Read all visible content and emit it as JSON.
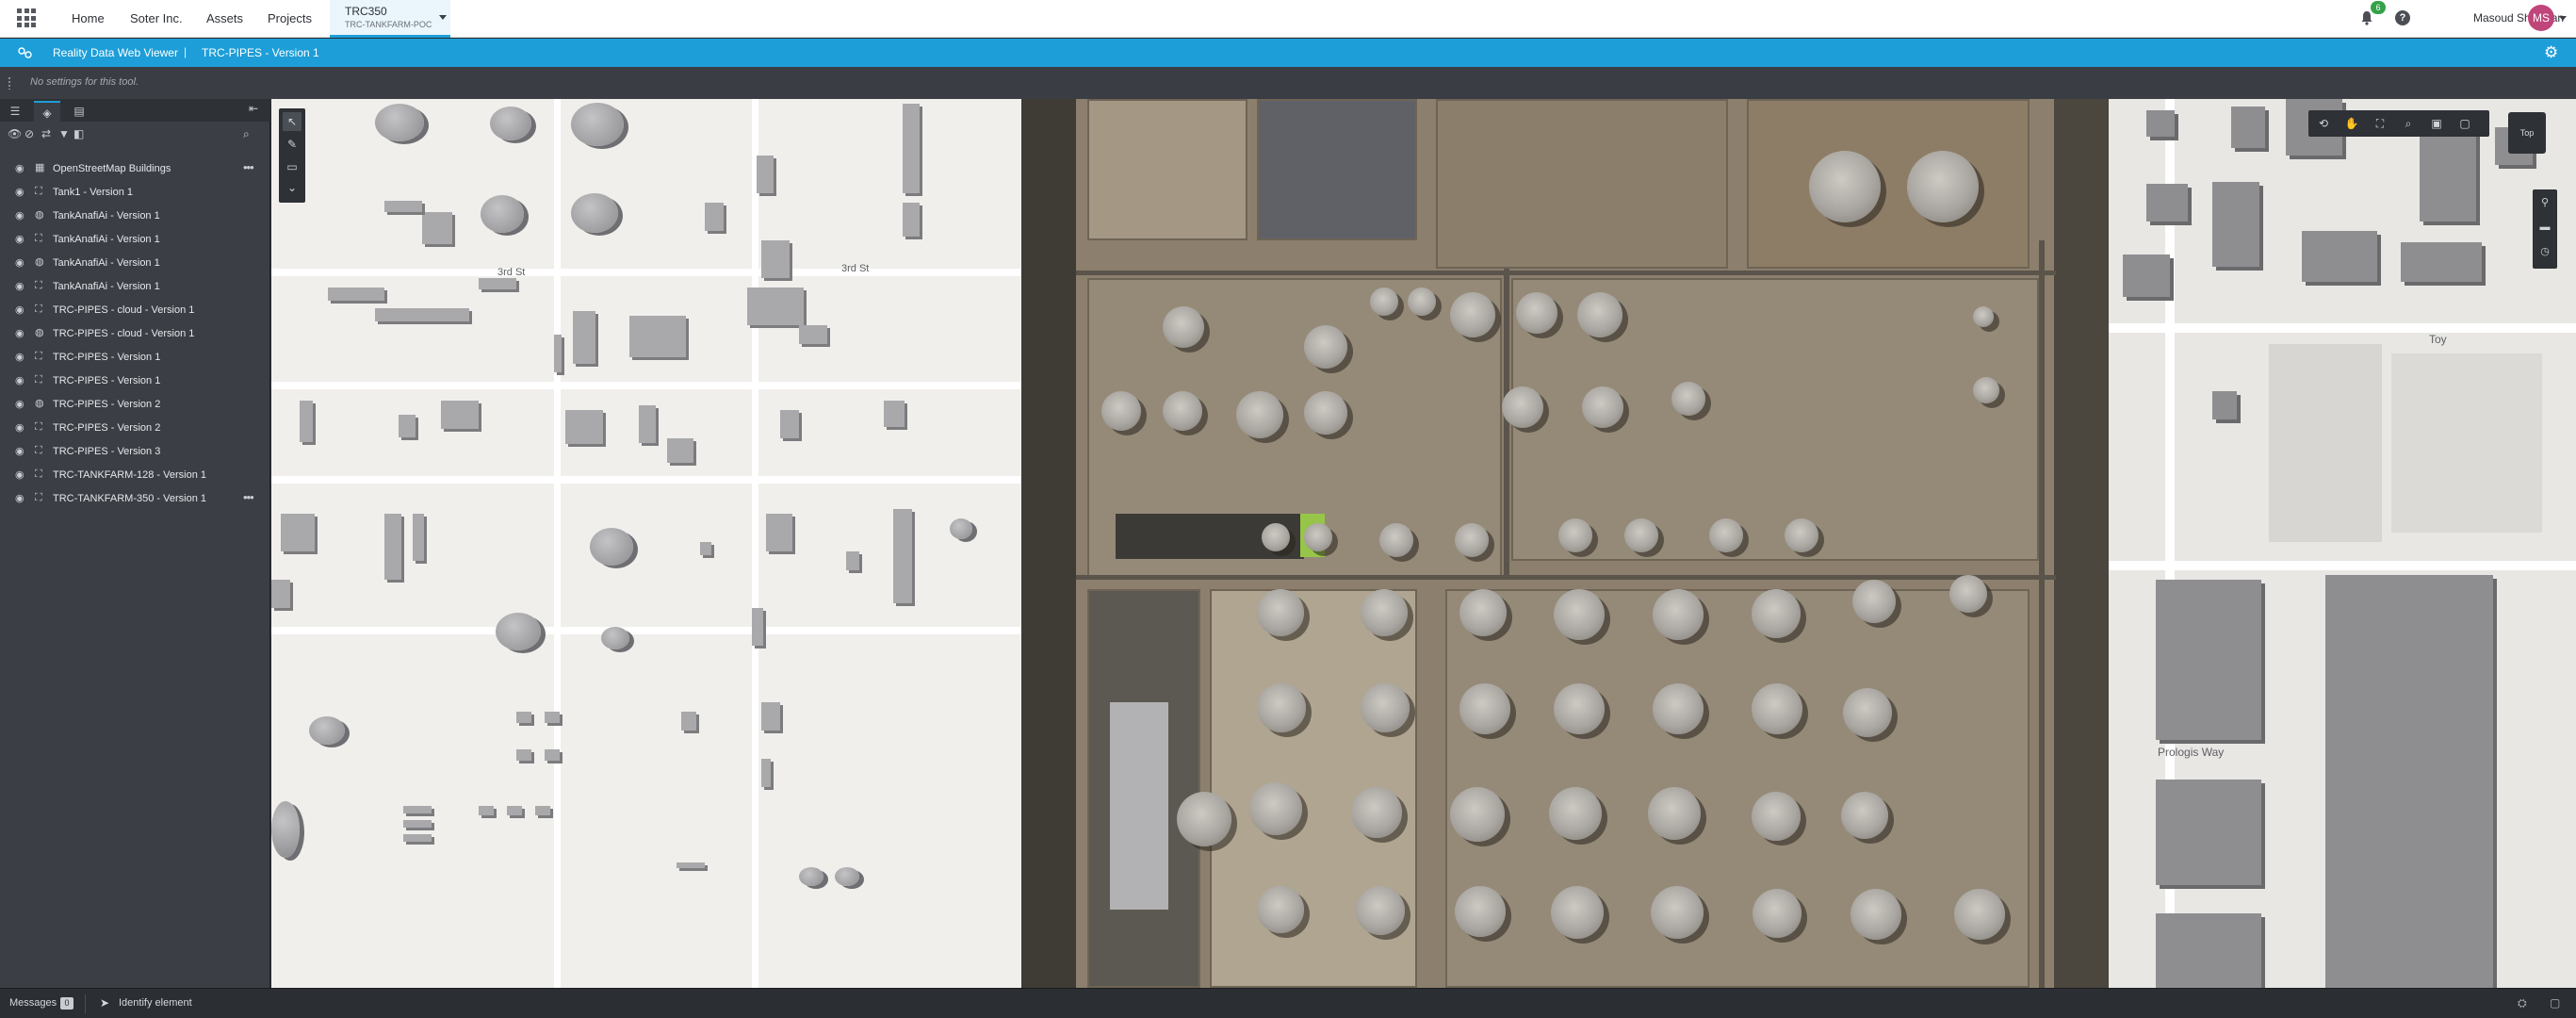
{
  "topnav": {
    "home": "Home",
    "org": "Soter Inc.",
    "assets": "Assets",
    "projects": "Projects",
    "project_tab": {
      "name": "TRC350",
      "subtitle": "TRC-TANKFARM-POC"
    },
    "notification_count": "6",
    "help": "?",
    "user_name": "Masoud Shirazian",
    "user_initials": "MS"
  },
  "appbar": {
    "app_title": "Reality Data Web Viewer",
    "separator": "|",
    "model_title": "TRC-PIPES - Version 1"
  },
  "tool_settings": {
    "message": "No settings for this tool."
  },
  "tree": {
    "items": [
      {
        "label": "OpenStreetMap Buildings",
        "has_menu": true
      },
      {
        "label": "Tank1 - Version 1"
      },
      {
        "label": "TankAnafiAi - Version 1"
      },
      {
        "label": "TankAnafiAi - Version 1"
      },
      {
        "label": "TankAnafiAi - Version 1"
      },
      {
        "label": "TankAnafiAi - Version 1"
      },
      {
        "label": "TRC-PIPES - cloud - Version 1"
      },
      {
        "label": "TRC-PIPES - cloud - Version 1"
      },
      {
        "label": "TRC-PIPES - Version 1"
      },
      {
        "label": "TRC-PIPES - Version 1"
      },
      {
        "label": "TRC-PIPES - Version 2"
      },
      {
        "label": "TRC-PIPES - Version 2"
      },
      {
        "label": "TRC-PIPES - Version 3"
      },
      {
        "label": "TRC-TANKFARM-128 - Version 1"
      },
      {
        "label": "TRC-TANKFARM-350 - Version 1",
        "has_menu": true
      }
    ]
  },
  "map": {
    "street_labels": [
      "3rd St",
      "3rd St",
      "Prologis Way",
      "Toy"
    ],
    "view_cube_label": "Top"
  },
  "statusbar": {
    "messages_label": "Messages",
    "messages_count": "0",
    "tool_label": "Identify element"
  },
  "colors": {
    "accent": "#1d9ed8",
    "panel": "#3b3f45",
    "badge": "#35a24a",
    "avatar": "#c0457a"
  }
}
